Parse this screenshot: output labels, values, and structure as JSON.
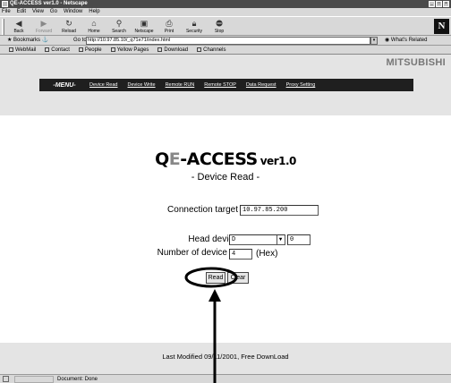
{
  "window": {
    "title": "QE-ACCESS ver1.0 - Netscape"
  },
  "menu": [
    "File",
    "Edit",
    "View",
    "Go",
    "Window",
    "Help"
  ],
  "toolbar": {
    "buttons": [
      {
        "label": "Back",
        "icon": "back-arrow-icon"
      },
      {
        "label": "Forward",
        "icon": "forward-arrow-icon"
      },
      {
        "label": "Reload",
        "icon": "reload-icon"
      },
      {
        "label": "Home",
        "icon": "home-icon"
      },
      {
        "label": "Search",
        "icon": "search-icon"
      },
      {
        "label": "Netscape",
        "icon": "netscape-icon"
      },
      {
        "label": "Print",
        "icon": "print-icon"
      },
      {
        "label": "Security",
        "icon": "security-icon"
      },
      {
        "label": "Stop",
        "icon": "stop-icon"
      }
    ]
  },
  "location": {
    "bookmarks": "Bookmarks",
    "goto": "Go to:",
    "url": "http://10.97.85.10/_q71e71/index.html",
    "related": "What's Related"
  },
  "personal": [
    "WebMail",
    "Contact",
    "People",
    "Yellow Pages",
    "Download",
    "Channels"
  ],
  "page": {
    "brand": "MITSUBISHI",
    "menu_label": "-MENU-",
    "menu_links": [
      "Device Read",
      "Device Write",
      "Remote RUN",
      "Remote STOP",
      "Data Request",
      "Proxy Setting"
    ],
    "title_q": "Q",
    "title_e": "E",
    "title_rest": "-ACCESS",
    "title_ver": "ver1.0",
    "subtitle": "- Device Read -",
    "connection_label": "Connection target",
    "connection_value": "10.97.85.200",
    "head_label": "Head device",
    "head_device": "D",
    "head_number": "0",
    "count_label": "Number of device",
    "count_value": "4",
    "hex_label": "(Hex)",
    "read_button": "Read",
    "clear_button": "Clear",
    "footer": "Last Modified 09/11/2001, Free DownLoad"
  },
  "status": {
    "text": "Document: Done"
  }
}
